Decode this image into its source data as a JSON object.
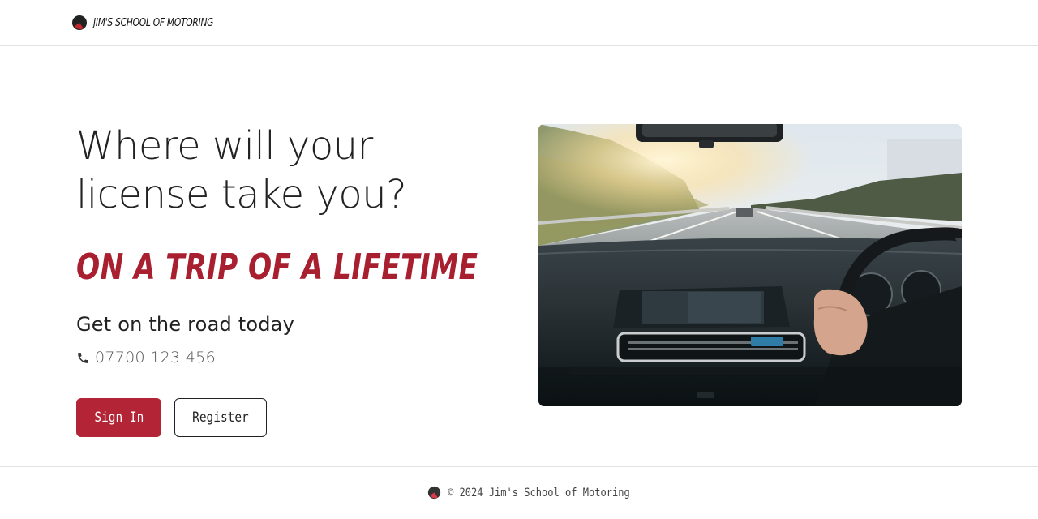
{
  "navbar": {
    "brand_name": "JIM'S SCHOOL OF MOTORING",
    "logo_icon": "half-circle-logo-icon"
  },
  "hero": {
    "title_line1": "Where will your",
    "title_line2": "license take you?",
    "tagline": "ON A TRIP OF A LIFETIME",
    "subtitle": "Get on the road today",
    "phone_icon": "phone-icon",
    "phone_number": "07700 123 456",
    "signin_label": "Sign In",
    "register_label": "Register",
    "image_description_icon": "car-dashboard-photo"
  },
  "footer": {
    "copyright": "© 2024 Jim's School of Motoring",
    "logo_icon": "half-circle-logo-icon"
  },
  "colors": {
    "accent": "#b32536",
    "tagline": "#a81f30",
    "text": "#222222",
    "border": "#e2e2e2"
  }
}
